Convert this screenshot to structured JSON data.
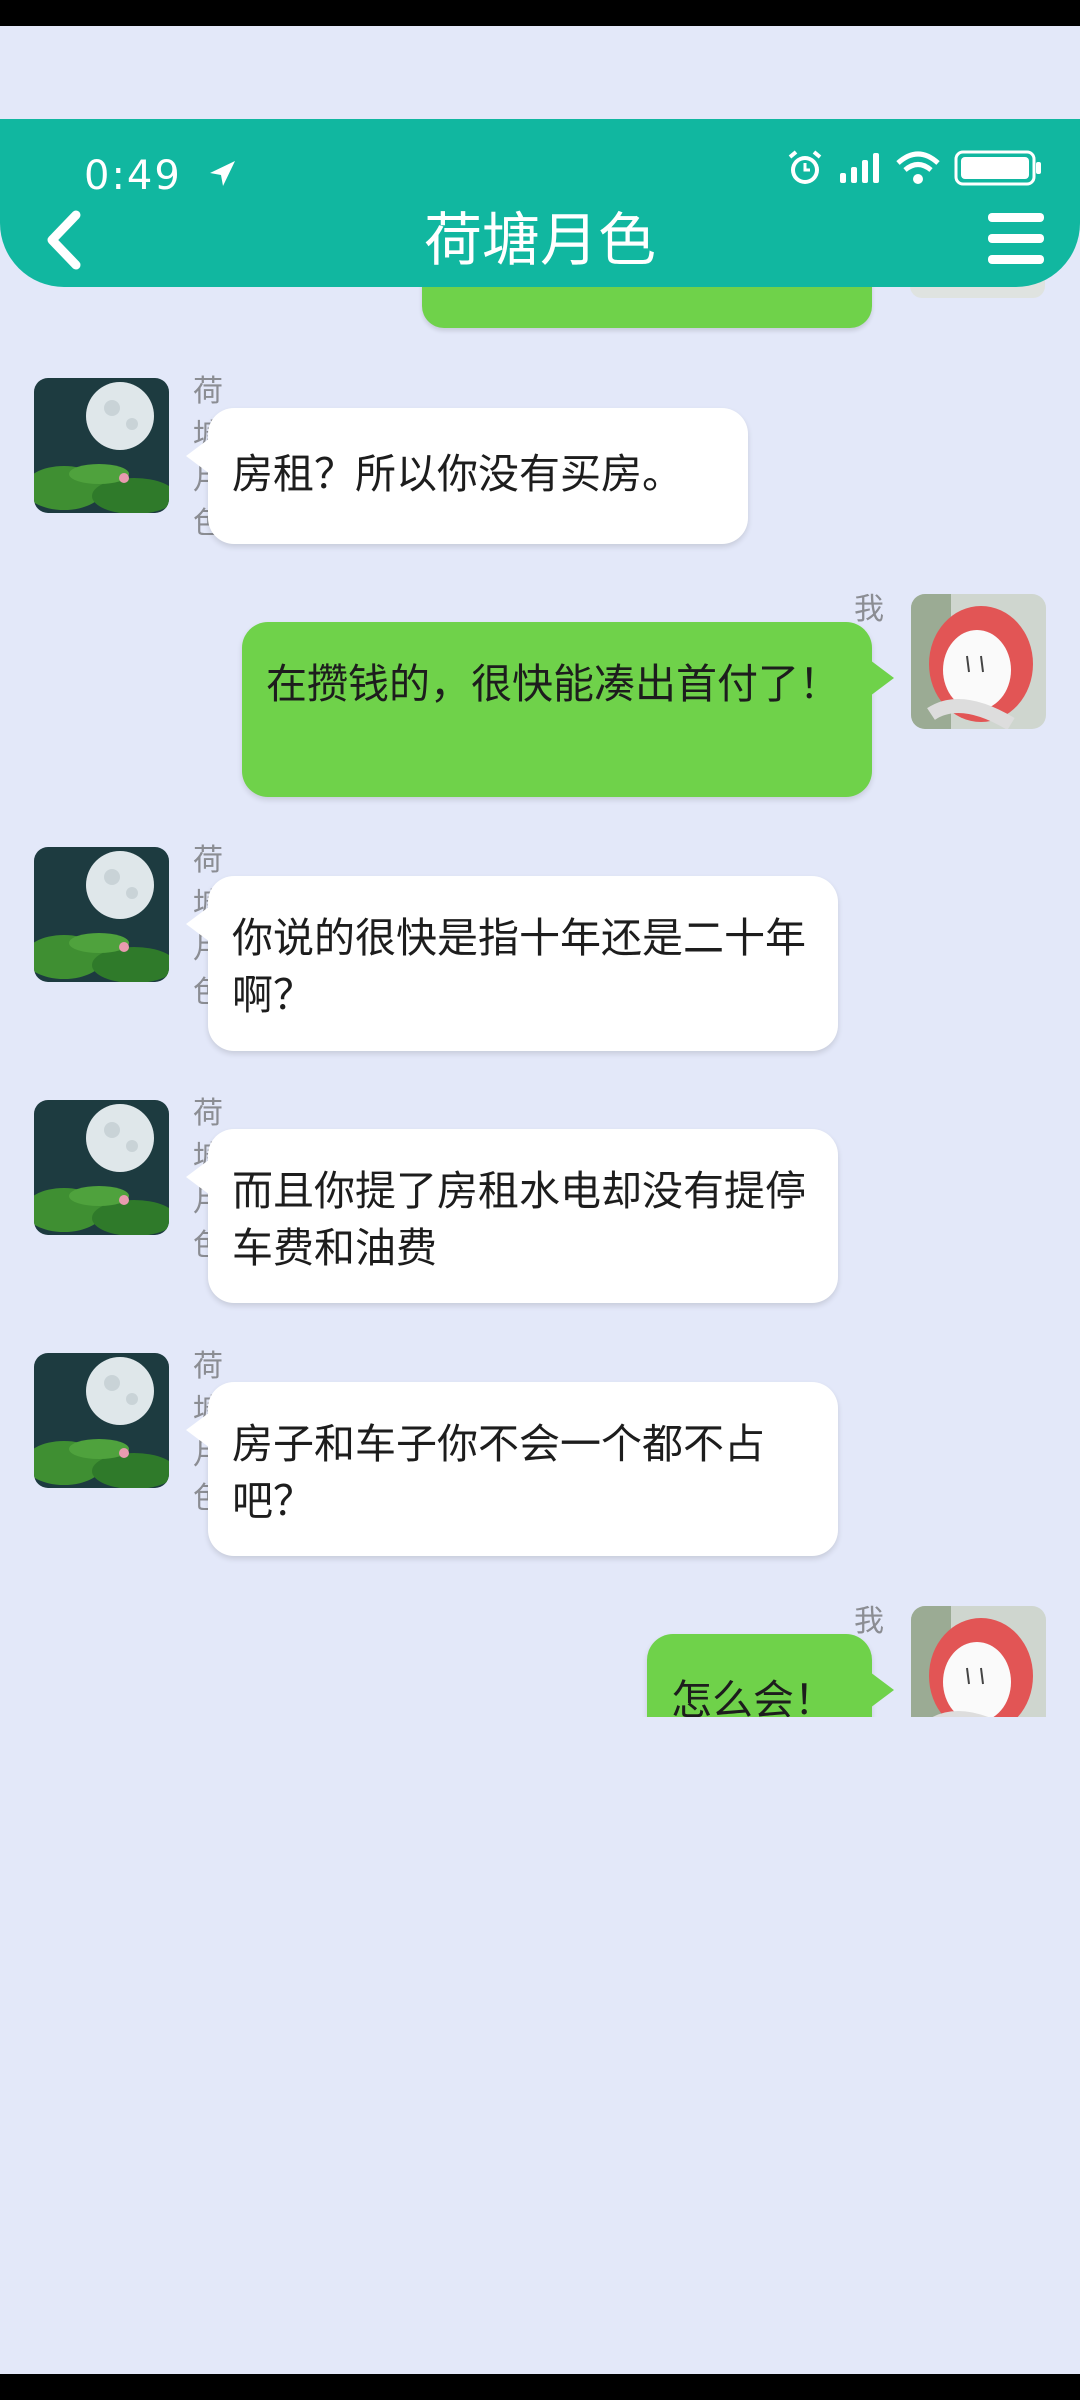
{
  "status_bar": {
    "time": "0:49"
  },
  "header": {
    "title": "荷塘月色"
  },
  "messages": [
    {
      "side": "in",
      "sender": "荷塘月色",
      "text": "房租？所以你没有买房。"
    },
    {
      "side": "out",
      "sender": "我",
      "text": "在攒钱的，很快能凑出首付了！"
    },
    {
      "side": "in",
      "sender": "荷塘月色",
      "text": "你说的很快是指十年还是二十年啊？"
    },
    {
      "side": "in",
      "sender": "荷塘月色",
      "text": "而且你提了房租水电却没有提停车费和油费"
    },
    {
      "side": "in",
      "sender": "荷塘月色",
      "text": "房子和车子你不会一个都不占吧？"
    },
    {
      "side": "out",
      "sender": "我",
      "text": "怎么会！"
    }
  ],
  "colors": {
    "header": "#11b7a0",
    "background": "#e3e8f9",
    "outgoing_bubble": "#6fd24a",
    "incoming_bubble": "#ffffff"
  }
}
